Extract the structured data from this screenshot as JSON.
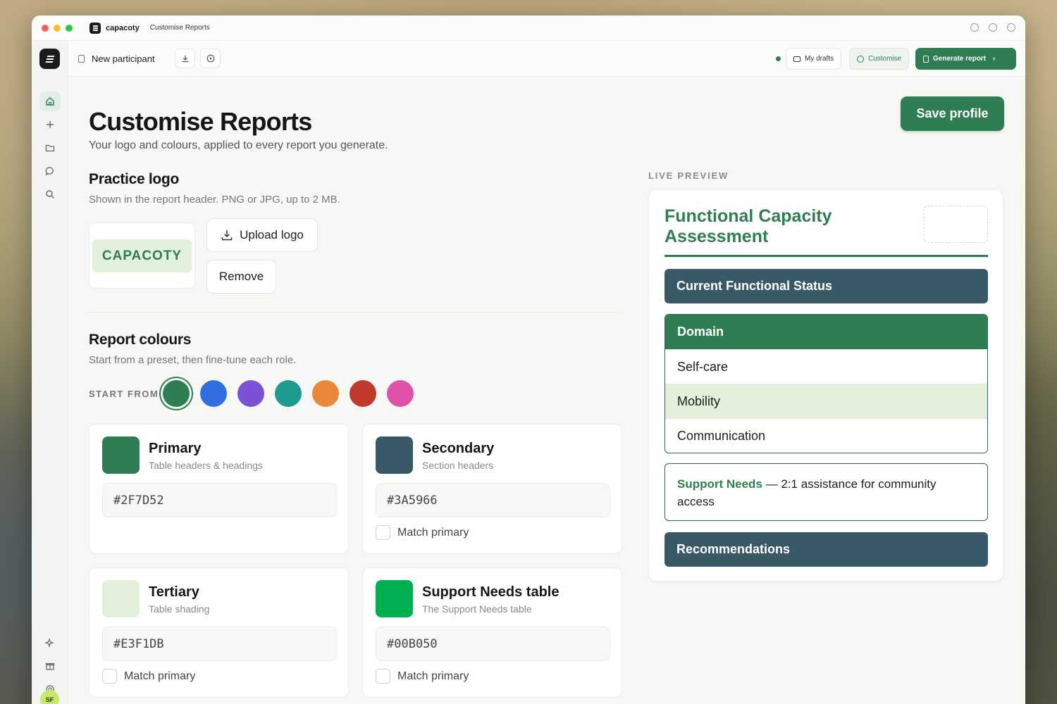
{
  "titlebar": {
    "app_name": "capacoty",
    "page_name": "Customise Reports"
  },
  "sidebar": {
    "items": [
      {
        "icon": "home-icon",
        "active": true
      },
      {
        "icon": "plus-icon"
      },
      {
        "icon": "folder-icon"
      },
      {
        "icon": "chat-icon"
      },
      {
        "icon": "search-icon"
      }
    ],
    "bottom_items": [
      "sparkle-icon",
      "gift-icon",
      "help-icon"
    ],
    "avatar_initials": "SF"
  },
  "topbar": {
    "document_title": "New participant",
    "my_drafts": "My drafts",
    "customise": "Customise",
    "generate_report": "Generate report"
  },
  "page": {
    "title": "Customise Reports",
    "subtitle": "Your logo and colours, applied to every report you generate.",
    "save_button": "Save profile"
  },
  "logo_section": {
    "title": "Practice logo",
    "subtitle": "Shown in the report header. PNG or JPG, up to 2 MB.",
    "logo_text": "CAPACOTY",
    "upload_button": "Upload logo",
    "remove_button": "Remove"
  },
  "colours_section": {
    "title": "Report colours",
    "subtitle": "Start from a preset, then fine-tune each role.",
    "start_from_label": "START FROM",
    "presets": [
      "#2F7D52",
      "#2F6FDF",
      "#7B52D6",
      "#1F9A8E",
      "#E9883A",
      "#C0392B",
      "#E052A8"
    ],
    "selected_preset": 0,
    "roles": [
      {
        "title": "Primary",
        "subtitle": "Table headers & headings",
        "hex": "#2F7D52",
        "match_label": ""
      },
      {
        "title": "Secondary",
        "subtitle": "Section headers",
        "hex": "#3A5966",
        "match_label": "Match primary"
      },
      {
        "title": "Tertiary",
        "subtitle": "Table shading",
        "hex": "#E3F1DB",
        "match_label": "Match primary"
      },
      {
        "title": "Support Needs table",
        "subtitle": "The Support Needs table",
        "hex": "#00B050",
        "match_label": "Match primary"
      }
    ]
  },
  "preview": {
    "label": "LIVE PREVIEW",
    "title": "Functional Capacity Assessment",
    "section_1": "Current Functional Status",
    "table_header": "Domain",
    "rows": [
      "Self-care",
      "Mobility",
      "Communication"
    ],
    "support_label": "Support Needs",
    "support_text": " — 2:1 assistance for community access",
    "section_2": "Recommendations"
  }
}
